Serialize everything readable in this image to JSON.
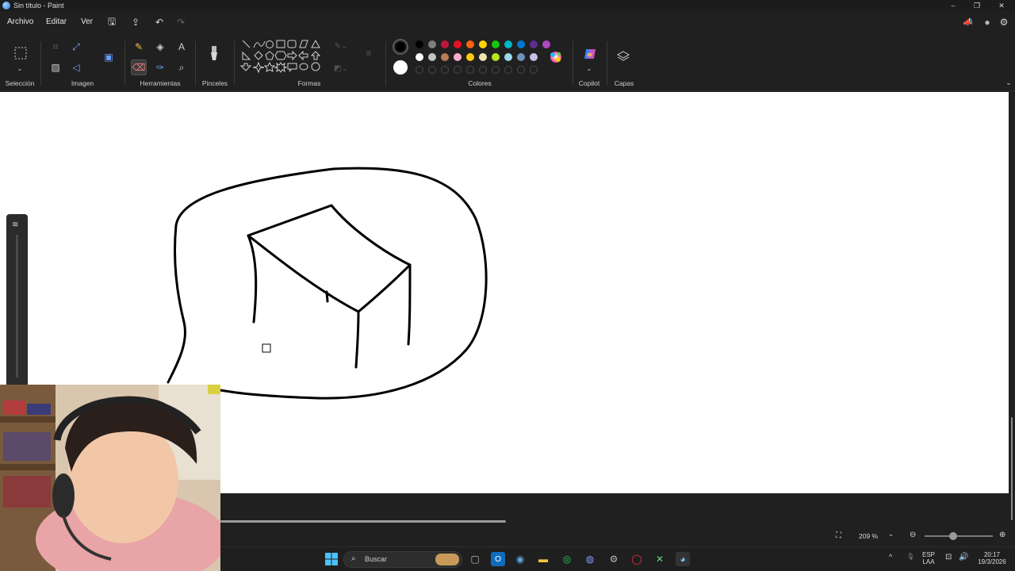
{
  "window": {
    "title": "Sin título - Paint",
    "controls": {
      "minimize": "–",
      "restore": "❐",
      "close": "✕"
    }
  },
  "menu": {
    "items": [
      "Archivo",
      "Editar",
      "Ver"
    ],
    "quick_access": {
      "save": "🖫",
      "share": "⇪",
      "undo": "↶",
      "redo": "↷"
    },
    "right_icons": {
      "feedback": "📣",
      "account": "●",
      "settings": "⚙"
    }
  },
  "ribbon": {
    "groups": {
      "selection": "Selección",
      "image": "Imagen",
      "tools": "Herramientas",
      "brushes": "Pinceles",
      "shapes": "Formas",
      "colors": "Colores",
      "copilot": "Copilot",
      "layers": "Capas"
    },
    "tools_glyphs": {
      "pencil": "✎",
      "fill": "◈",
      "text": "A",
      "eraser": "⌫",
      "picker": "✑",
      "zoom": "⌕"
    },
    "active_tool": "eraser",
    "primary_color": "#000000",
    "secondary_color": "#ffffff",
    "palette_row1": [
      "#000000",
      "#7f7f7f",
      "#c0143c",
      "#e81123",
      "#f7630c",
      "#ffd400",
      "#16c60c",
      "#00b7c3",
      "#0078d4",
      "#5c2d91",
      "#b146c2"
    ],
    "palette_row2": [
      "#ffffff",
      "#c3c3c3",
      "#b97a57",
      "#ffaec9",
      "#ffc90e",
      "#efe4b0",
      "#b5e61d",
      "#99d9ea",
      "#7092be",
      "#c8bfe7"
    ],
    "custom_slots": 10
  },
  "statusbar": {
    "zoom": "209 %",
    "zoom_chevron": "⌄",
    "zoom_out": "⊖",
    "zoom_in": "⊕",
    "zoom_slider_level": 0.42
  },
  "taskbar": {
    "search_label": "Buscar",
    "apps": [
      "start",
      "file-explorer",
      "outlook",
      "steam",
      "files",
      "whatsapp",
      "discord",
      "settings",
      "opera",
      "xbox",
      "paint"
    ],
    "tray": {
      "language_1": "ESP",
      "language_2": "LAA",
      "time": "20:17",
      "date": "19/3/2026",
      "chevron": "^"
    }
  }
}
